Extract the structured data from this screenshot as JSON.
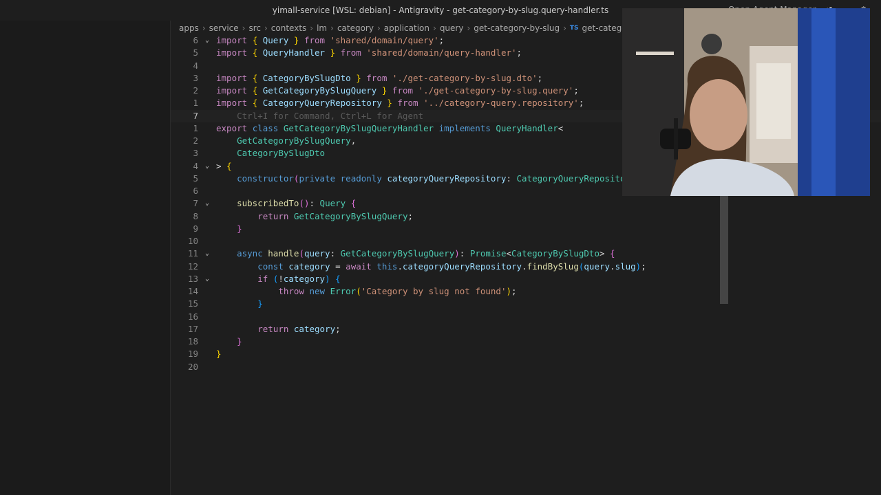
{
  "window": {
    "title": "yimall-service [WSL: debian] - Antigravity - get-category-by-slug.query-handler.ts",
    "right_text": "Open Agent Manager"
  },
  "breadcrumb": [
    "apps",
    "service",
    "src",
    "contexts",
    "lm",
    "category",
    "application",
    "query",
    "get-category-by-slug"
  ],
  "breadcrumb_file": "get-category-by",
  "breadcrumb_file_badge": "TS",
  "code_lines": [
    {
      "ln": "6",
      "fold": "chevron-down",
      "tokens": [
        [
          "kw",
          "import "
        ],
        [
          "b1",
          "{ "
        ],
        [
          "va",
          "Query"
        ],
        [
          "b1",
          " }"
        ],
        [
          "kw",
          " from "
        ],
        [
          "str",
          "'shared/domain/query'"
        ],
        [
          "pl",
          ";"
        ]
      ]
    },
    {
      "ln": "5",
      "tokens": [
        [
          "kw",
          "import "
        ],
        [
          "b1",
          "{ "
        ],
        [
          "va",
          "QueryHandler"
        ],
        [
          "b1",
          " }"
        ],
        [
          "kw",
          " from "
        ],
        [
          "str",
          "'shared/domain/query-handler'"
        ],
        [
          "pl",
          ";"
        ]
      ]
    },
    {
      "ln": "4",
      "tokens": []
    },
    {
      "ln": "3",
      "tokens": [
        [
          "kw",
          "import "
        ],
        [
          "b1",
          "{ "
        ],
        [
          "va",
          "CategoryBySlugDto"
        ],
        [
          "b1",
          " }"
        ],
        [
          "kw",
          " from "
        ],
        [
          "str",
          "'./get-category-by-slug.dto'"
        ],
        [
          "pl",
          ";"
        ]
      ]
    },
    {
      "ln": "2",
      "tokens": [
        [
          "kw",
          "import "
        ],
        [
          "b1",
          "{ "
        ],
        [
          "va",
          "GetCategoryBySlugQuery"
        ],
        [
          "b1",
          " }"
        ],
        [
          "kw",
          " from "
        ],
        [
          "str",
          "'./get-category-by-slug.query'"
        ],
        [
          "pl",
          ";"
        ]
      ]
    },
    {
      "ln": "1",
      "tokens": [
        [
          "kw",
          "import "
        ],
        [
          "b1",
          "{ "
        ],
        [
          "va",
          "CategoryQueryRepository"
        ],
        [
          "b1",
          " }"
        ],
        [
          "kw",
          " from "
        ],
        [
          "str",
          "'../category-query.repository'"
        ],
        [
          "pl",
          ";"
        ]
      ]
    },
    {
      "ln": "7",
      "current": true,
      "tokens": [
        [
          "hint",
          "    Ctrl+I for Command, Ctrl+L for Agent"
        ]
      ]
    },
    {
      "ln": "1",
      "tokens": [
        [
          "kw",
          "export"
        ],
        [
          "pl",
          " "
        ],
        [
          "st",
          "class "
        ],
        [
          "ty",
          "GetCategoryBySlugQueryHandler"
        ],
        [
          "st",
          " implements "
        ],
        [
          "ty",
          "QueryHandler"
        ],
        [
          "pl",
          "<"
        ]
      ]
    },
    {
      "ln": "2",
      "tokens": [
        [
          "pl",
          "    "
        ],
        [
          "ty",
          "GetCategoryBySlugQuery"
        ],
        [
          "pl",
          ","
        ]
      ]
    },
    {
      "ln": "3",
      "tokens": [
        [
          "pl",
          "    "
        ],
        [
          "ty",
          "CategoryBySlugDto"
        ]
      ]
    },
    {
      "ln": "4",
      "fold": "chevron-down",
      "tokens": [
        [
          "pl",
          "> "
        ],
        [
          "b1",
          "{"
        ]
      ]
    },
    {
      "ln": "5",
      "tokens": [
        [
          "pl",
          "    "
        ],
        [
          "st",
          "constructor"
        ],
        [
          "b2",
          "("
        ],
        [
          "st",
          "private readonly "
        ],
        [
          "va",
          "categoryQueryRepository"
        ],
        [
          "pl",
          ": "
        ],
        [
          "ty",
          "CategoryQueryRepository"
        ],
        [
          "b2",
          ")"
        ],
        [
          "pl",
          " "
        ],
        [
          "b2",
          "{}"
        ]
      ]
    },
    {
      "ln": "6",
      "tokens": []
    },
    {
      "ln": "7",
      "fold": "chevron-down",
      "tokens": [
        [
          "pl",
          "    "
        ],
        [
          "fn",
          "subscribedTo"
        ],
        [
          "b2",
          "()"
        ],
        [
          "pl",
          ": "
        ],
        [
          "ty",
          "Query"
        ],
        [
          "pl",
          " "
        ],
        [
          "b2",
          "{"
        ]
      ]
    },
    {
      "ln": "8",
      "tokens": [
        [
          "pl",
          "        "
        ],
        [
          "kw",
          "return "
        ],
        [
          "ty",
          "GetCategoryBySlugQuery"
        ],
        [
          "pl",
          ";"
        ]
      ]
    },
    {
      "ln": "9",
      "tokens": [
        [
          "pl",
          "    "
        ],
        [
          "b2",
          "}"
        ]
      ]
    },
    {
      "ln": "10",
      "tokens": []
    },
    {
      "ln": "11",
      "fold": "chevron-down",
      "tokens": [
        [
          "pl",
          "    "
        ],
        [
          "st",
          "async "
        ],
        [
          "fn",
          "handle"
        ],
        [
          "b2",
          "("
        ],
        [
          "va",
          "query"
        ],
        [
          "pl",
          ": "
        ],
        [
          "ty",
          "GetCategoryBySlugQuery"
        ],
        [
          "b2",
          ")"
        ],
        [
          "pl",
          ": "
        ],
        [
          "ty",
          "Promise"
        ],
        [
          "pl",
          "<"
        ],
        [
          "ty",
          "CategoryBySlugDto"
        ],
        [
          "pl",
          "> "
        ],
        [
          "b2",
          "{"
        ]
      ]
    },
    {
      "ln": "12",
      "tokens": [
        [
          "pl",
          "        "
        ],
        [
          "st",
          "const "
        ],
        [
          "va",
          "category"
        ],
        [
          "pl",
          " = "
        ],
        [
          "kw",
          "await "
        ],
        [
          "st",
          "this"
        ],
        [
          "pl",
          "."
        ],
        [
          "va",
          "categoryQueryRepository"
        ],
        [
          "pl",
          "."
        ],
        [
          "fn",
          "findBySlug"
        ],
        [
          "b3",
          "("
        ],
        [
          "va",
          "query"
        ],
        [
          "pl",
          "."
        ],
        [
          "va",
          "slug"
        ],
        [
          "b3",
          ")"
        ],
        [
          "pl",
          ";"
        ]
      ]
    },
    {
      "ln": "13",
      "fold": "chevron-down",
      "tokens": [
        [
          "pl",
          "        "
        ],
        [
          "kw",
          "if "
        ],
        [
          "b3",
          "("
        ],
        [
          "pl",
          "!"
        ],
        [
          "va",
          "category"
        ],
        [
          "b3",
          ")"
        ],
        [
          "pl",
          " "
        ],
        [
          "b3",
          "{"
        ]
      ]
    },
    {
      "ln": "14",
      "tokens": [
        [
          "pl",
          "            "
        ],
        [
          "kw",
          "throw "
        ],
        [
          "st",
          "new "
        ],
        [
          "ty",
          "Error"
        ],
        [
          "b1",
          "("
        ],
        [
          "str",
          "'Category by slug not found'"
        ],
        [
          "b1",
          ")"
        ],
        [
          "pl",
          ";"
        ]
      ]
    },
    {
      "ln": "15",
      "tokens": [
        [
          "pl",
          "        "
        ],
        [
          "b3",
          "}"
        ]
      ]
    },
    {
      "ln": "16",
      "tokens": []
    },
    {
      "ln": "17",
      "tokens": [
        [
          "pl",
          "        "
        ],
        [
          "kw",
          "return "
        ],
        [
          "va",
          "category"
        ],
        [
          "pl",
          ";"
        ]
      ]
    },
    {
      "ln": "18",
      "tokens": [
        [
          "pl",
          "    "
        ],
        [
          "b2",
          "}"
        ]
      ]
    },
    {
      "ln": "19",
      "tokens": [
        [
          "b1",
          "}"
        ]
      ]
    },
    {
      "ln": "20",
      "tokens": []
    }
  ]
}
